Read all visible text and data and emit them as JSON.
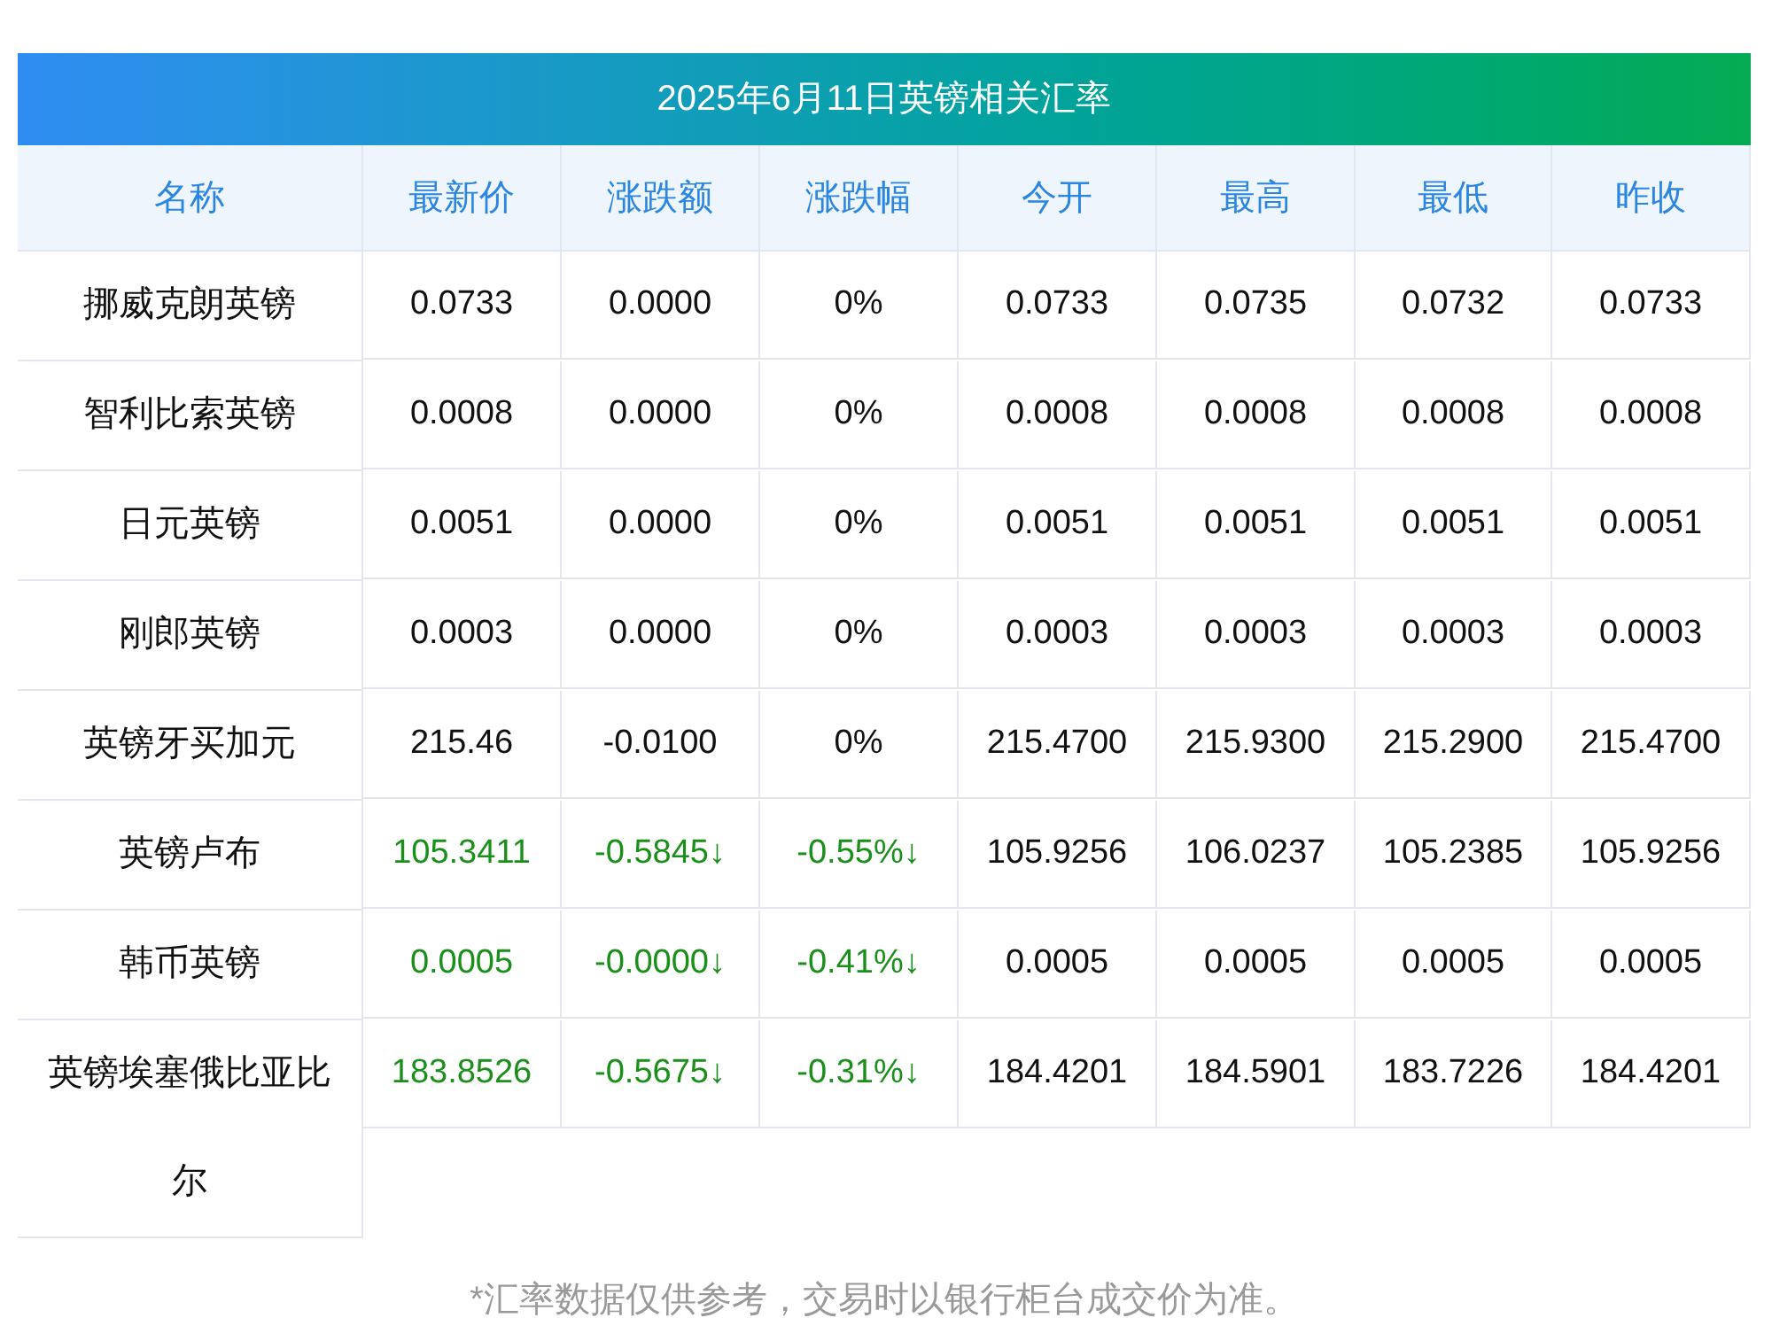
{
  "title": "2025年6月11日英镑相关汇率",
  "columns": [
    "名称",
    "最新价",
    "涨跌额",
    "涨跌幅",
    "今开",
    "最高",
    "最低",
    "昨收"
  ],
  "rows": [
    {
      "falling": false,
      "cells": [
        "挪威克朗英镑",
        "0.0733",
        "0.0000",
        "0%",
        "0.0733",
        "0.0735",
        "0.0732",
        "0.0733"
      ]
    },
    {
      "falling": false,
      "cells": [
        "智利比索英镑",
        "0.0008",
        "0.0000",
        "0%",
        "0.0008",
        "0.0008",
        "0.0008",
        "0.0008"
      ]
    },
    {
      "falling": false,
      "cells": [
        "日元英镑",
        "0.0051",
        "0.0000",
        "0%",
        "0.0051",
        "0.0051",
        "0.0051",
        "0.0051"
      ]
    },
    {
      "falling": false,
      "cells": [
        "刚郎英镑",
        "0.0003",
        "0.0000",
        "0%",
        "0.0003",
        "0.0003",
        "0.0003",
        "0.0003"
      ]
    },
    {
      "falling": false,
      "cells": [
        "英镑牙买加元",
        "215.46",
        "-0.0100",
        "0%",
        "215.4700",
        "215.9300",
        "215.2900",
        "215.4700"
      ]
    },
    {
      "falling": true,
      "cells": [
        "英镑卢布",
        "105.3411",
        "-0.5845↓",
        "-0.55%↓",
        "105.9256",
        "106.0237",
        "105.2385",
        "105.9256"
      ]
    },
    {
      "falling": true,
      "cells": [
        "韩币英镑",
        "0.0005",
        "-0.0000↓",
        "-0.41%↓",
        "0.0005",
        "0.0005",
        "0.0005",
        "0.0005"
      ]
    },
    {
      "falling": true,
      "cells": [
        "英镑埃塞俄比亚比尔",
        "183.8526",
        "-0.5675↓",
        "-0.31%↓",
        "184.4201",
        "184.5901",
        "183.7226",
        "184.4201"
      ]
    }
  ],
  "footnote": "*汇率数据仅供参考，交易时以银行柜台成交价为准。"
}
